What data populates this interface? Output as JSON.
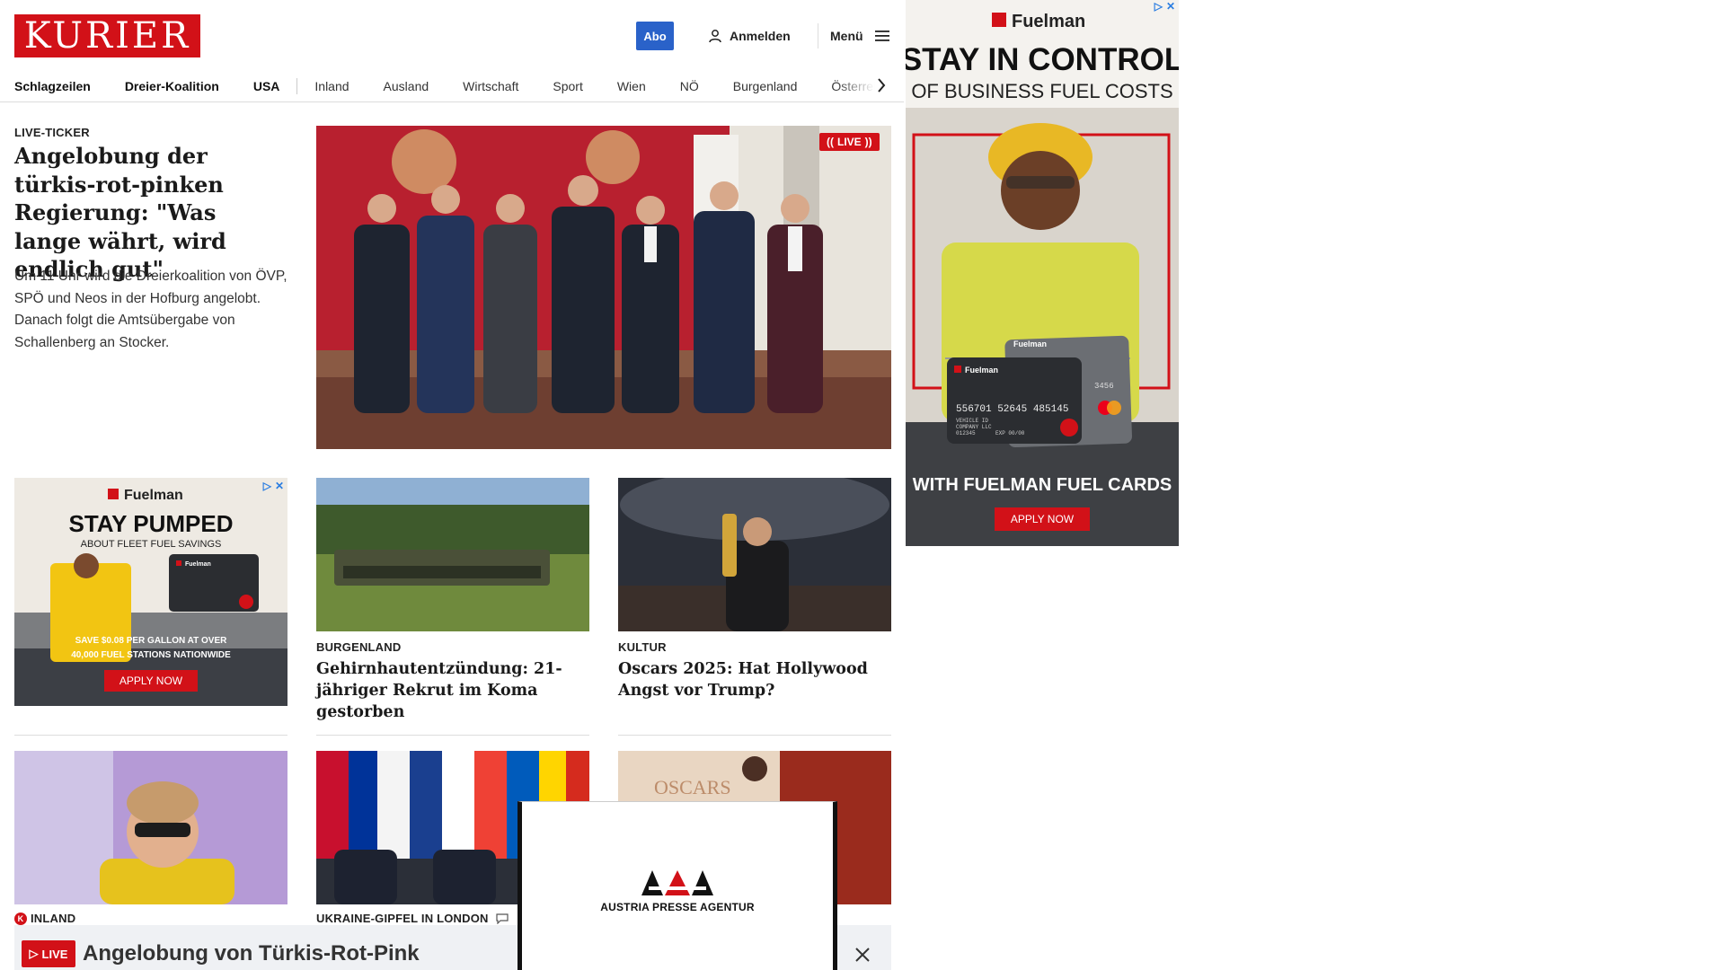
{
  "header": {
    "logo_text": "KURIER",
    "abo_label": "Abo",
    "login_label": "Anmelden",
    "menu_label": "Menü"
  },
  "nav": {
    "items": [
      "Schlagzeilen",
      "Dreier-Koalition",
      "USA",
      "Inland",
      "Ausland",
      "Wirtschaft",
      "Sport",
      "Wien",
      "NÖ",
      "Burgenland",
      "Österreich"
    ]
  },
  "lead": {
    "kicker": "LIVE-TICKER",
    "title": "Angelobung der türkis-rot-pinken Regierung: \"Was lange währt, wird endlich gut\"",
    "teaser": "Um 11 Uhr wird die Dreierkoalition von ÖVP, SPÖ und Neos in der Hofburg angelobt. Danach folgt die Amtsübergabe von Schallenberg an Stocker.",
    "live_badge": "LIVE"
  },
  "ad_small": {
    "brand": "Fuelman",
    "headline": "STAY PUMPED",
    "subline": "ABOUT FLEET FUEL SAVINGS",
    "body": "SAVE $0.08 PER GALLON AT OVER 40,000 FUEL STATIONS NATIONWIDE",
    "cta": "APPLY NOW"
  },
  "cards": [
    {
      "kicker": "BURGENLAND",
      "title": "Gehirnhautentzündung: 21-jähriger Rekrut im Koma gestorben"
    },
    {
      "kicker": "KULTUR",
      "title": "Oscars 2025: Hat Hollywood Angst vor Trump?"
    }
  ],
  "cards_row2": [
    {
      "kicker": "INLAND"
    },
    {
      "kicker": "UKRAINE-GIPFEL IN LONDON"
    },
    {
      "kicker": ""
    }
  ],
  "ad_right": {
    "brand": "Fuelman",
    "headline": "STAY IN CONTROL",
    "subline": "OF BUSINESS FUEL COSTS",
    "card_number": "556701 52645 485145",
    "card_tail": "3456",
    "card_text_1": "VEHICLE ID",
    "card_text_2": "COMPANY LLC",
    "card_text_3": "012345",
    "card_text_4": "EXP 00/00",
    "tagline": "WITH FUELMAN FUEL CARDS",
    "cta": "APPLY NOW"
  },
  "sticky": {
    "live_label": "LIVE",
    "title": "Angelobung von Türkis-Rot-Pink"
  },
  "apa": {
    "label": "AUSTRIA PRESSE AGENTUR"
  },
  "colors": {
    "brand_red": "#d21118",
    "abo_blue": "#2a62c9",
    "sticky_bg": "#eff1f4"
  }
}
